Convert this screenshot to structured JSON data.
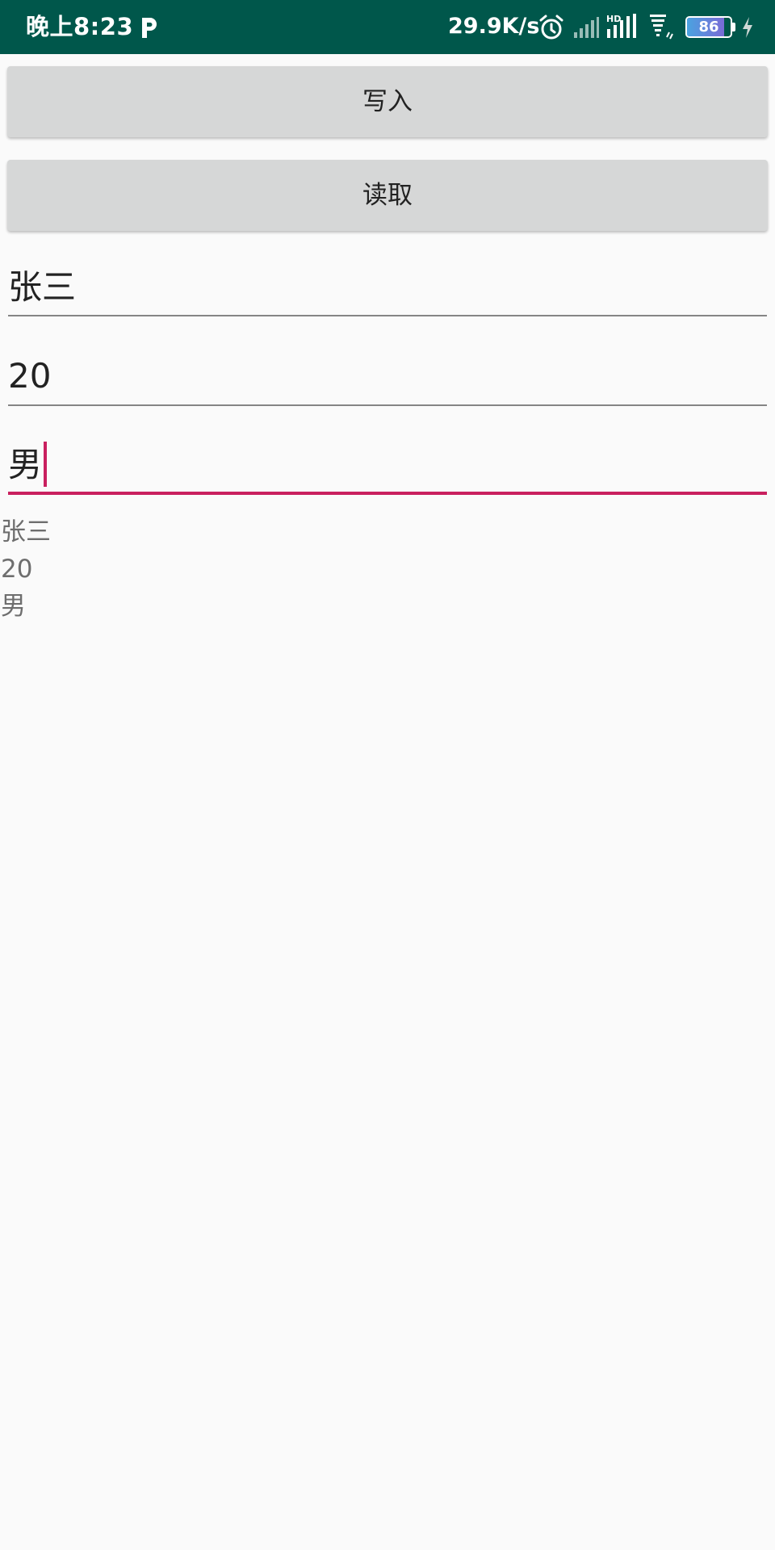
{
  "status_bar": {
    "time": "晚上8:23",
    "net_speed": "29.9K/s",
    "battery_level": "86",
    "battery_fraction": 0.86,
    "icons": [
      "parking-p-icon",
      "alarm-icon",
      "signal-icon",
      "hd-signal-icon",
      "wifi-icon",
      "battery-icon",
      "charging-icon"
    ],
    "background_color": "#00574b"
  },
  "buttons": {
    "write_label": "写入",
    "read_label": "读取"
  },
  "fields": {
    "name_value": "张三",
    "age_value": "20",
    "gender_value": "男",
    "focused_field": "gender",
    "accent_color": "#c9205f"
  },
  "output": {
    "lines": [
      "张三",
      "20",
      "男"
    ]
  }
}
